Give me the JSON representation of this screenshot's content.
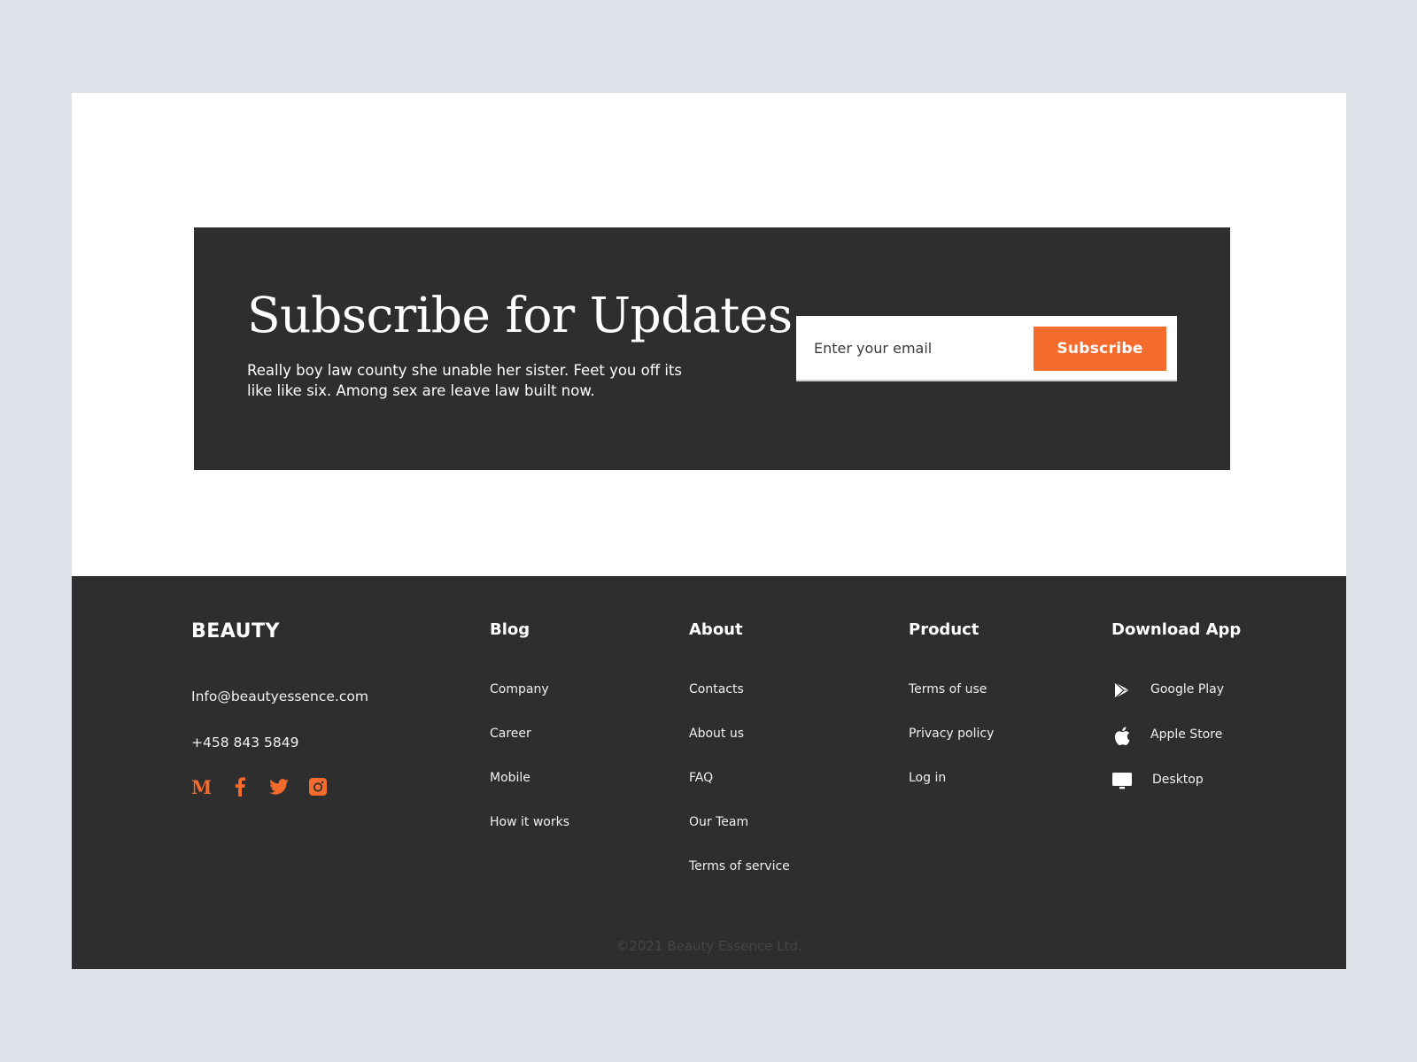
{
  "subscribe": {
    "title": "Subscribe for Updates",
    "description": "Really boy law county she unable her sister. Feet you off its like like six. Among sex are leave law built now.",
    "email_placeholder": "Enter your email",
    "email_value": "",
    "button_label": "Subscribe"
  },
  "footer": {
    "brand": "BEAUTY",
    "email": "Info@beautyessence.com",
    "phone": "+458 843 5849",
    "socials": [
      {
        "name": "medium-icon"
      },
      {
        "name": "facebook-icon"
      },
      {
        "name": "twitter-icon"
      },
      {
        "name": "instagram-icon"
      }
    ],
    "columns": {
      "blog": {
        "title": "Blog",
        "items": [
          "Company",
          "Career",
          "Mobile",
          "How it works"
        ]
      },
      "about": {
        "title": "About",
        "items": [
          "Contacts",
          "About us",
          "FAQ",
          "Our Team",
          "Terms of service"
        ]
      },
      "product": {
        "title": "Product",
        "items": [
          "Terms of use",
          "Privacy policy",
          "Log in"
        ]
      },
      "download": {
        "title": "Download App",
        "items": [
          {
            "label": "Google Play",
            "icon": "google-play-icon"
          },
          {
            "label": "Apple Store",
            "icon": "apple-icon"
          },
          {
            "label": "Desktop",
            "icon": "desktop-icon"
          }
        ]
      }
    },
    "copyright": "©2021 Beauty Essence Ltd."
  },
  "colors": {
    "accent": "#f56a2d",
    "dark": "#2e2e2e",
    "background": "#dee1e8"
  }
}
